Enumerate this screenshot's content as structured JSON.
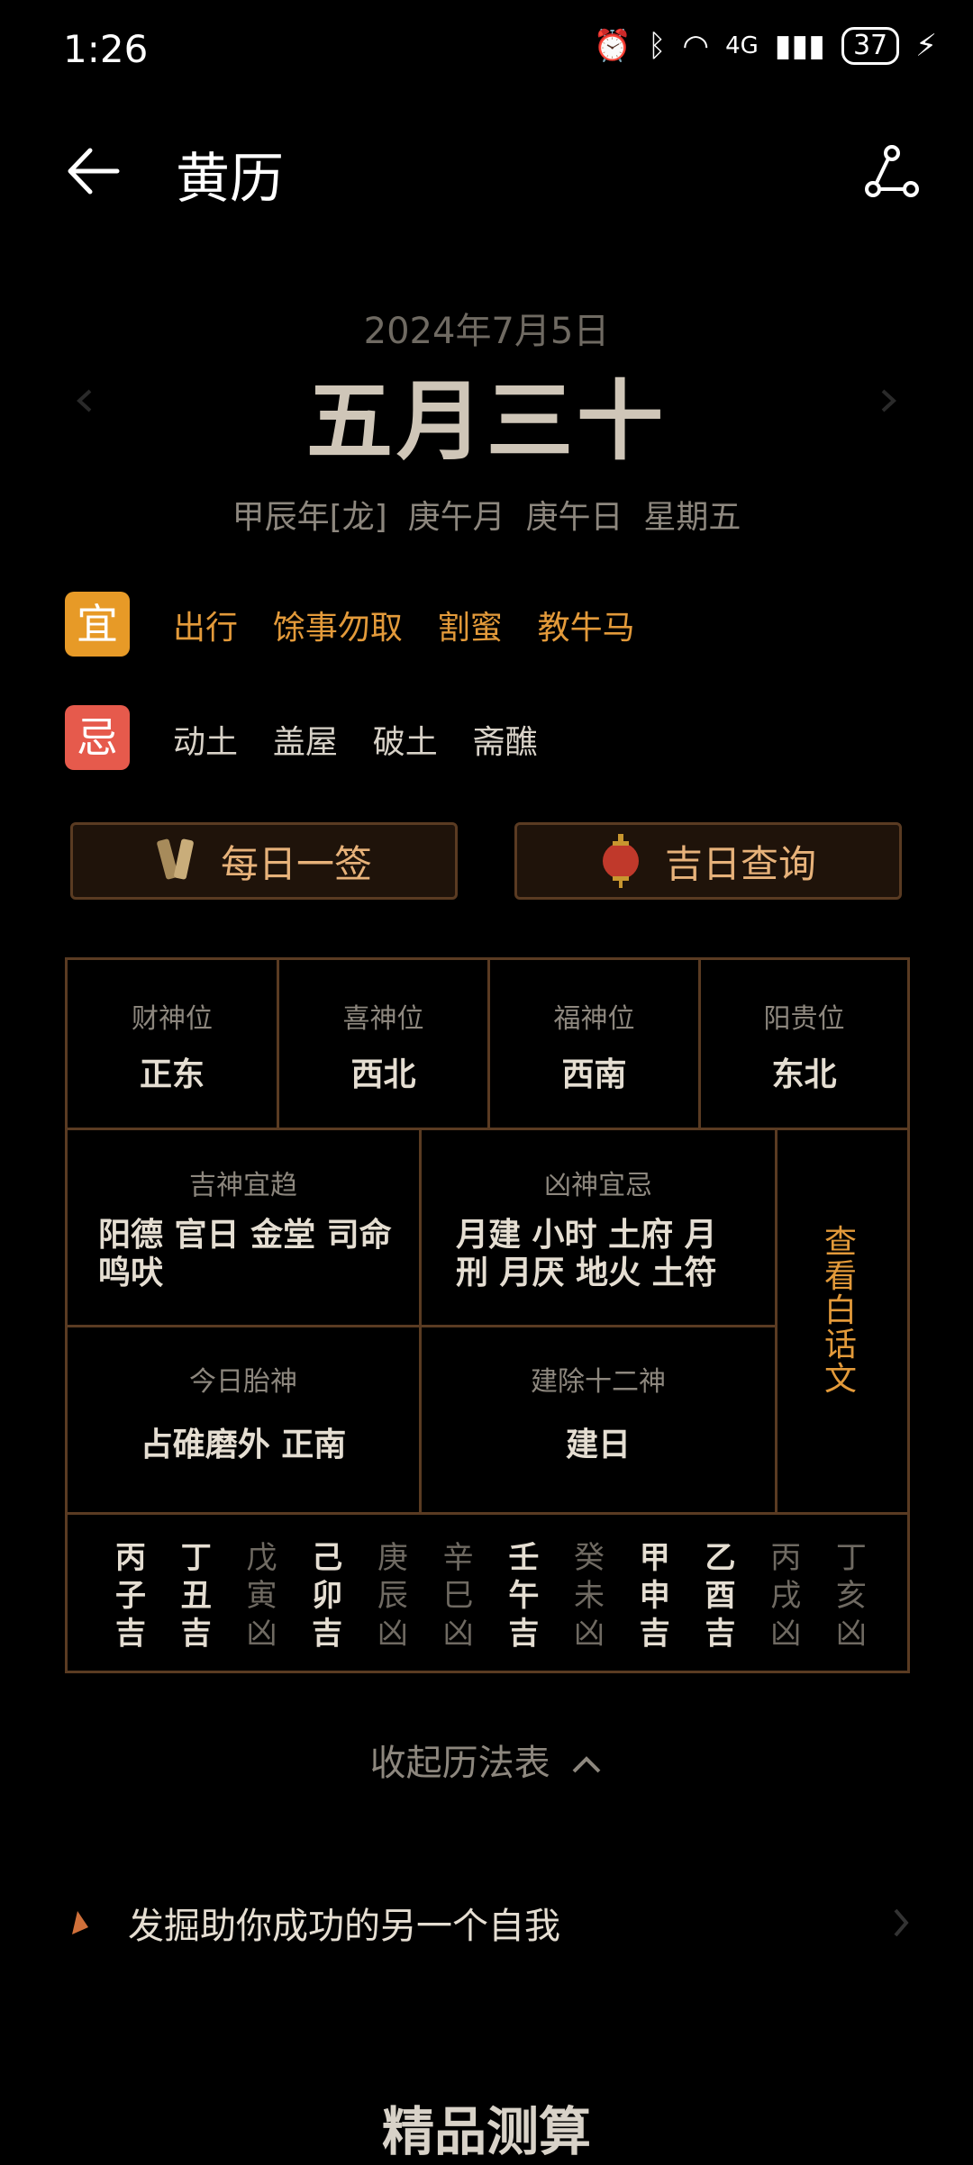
{
  "status": {
    "time": "1:26",
    "battery": "37",
    "network": "4G"
  },
  "header": {
    "title": "黄历"
  },
  "date": {
    "gregorian": "2024年7月5日",
    "lunar": "五月三十",
    "ganzhi": "甲辰年[龙]  庚午月  庚午日  星期五"
  },
  "yi": {
    "badge": "宜",
    "items": "出行  馀事勿取  割蜜  教牛马"
  },
  "ji": {
    "badge": "忌",
    "items": "动土  盖屋  破土  斋醮"
  },
  "buttons": {
    "daily": "每日一签",
    "lucky": "吉日查询"
  },
  "table": {
    "directions": [
      {
        "label": "财神位",
        "value": "正东"
      },
      {
        "label": "喜神位",
        "value": "西北"
      },
      {
        "label": "福神位",
        "value": "西南"
      },
      {
        "label": "阳贵位",
        "value": "东北"
      }
    ],
    "jishen": {
      "label": "吉神宜趋",
      "value": "阳德 官日 金堂 司命 鸣吠"
    },
    "xiongshen": {
      "label": "凶神宜忌",
      "value": "月建 小时 土府 月刑 月厌 地火 土符"
    },
    "view_text": "查看白话文",
    "taishen": {
      "label": "今日胎神",
      "value": "占碓磨外 正南"
    },
    "jianchu": {
      "label": "建除十二神",
      "value": "建日"
    },
    "hours": [
      {
        "stem": "丙",
        "branch": "子",
        "luck": "吉"
      },
      {
        "stem": "丁",
        "branch": "丑",
        "luck": "吉"
      },
      {
        "stem": "戊",
        "branch": "寅",
        "luck": "凶"
      },
      {
        "stem": "己",
        "branch": "卯",
        "luck": "吉"
      },
      {
        "stem": "庚",
        "branch": "辰",
        "luck": "凶"
      },
      {
        "stem": "辛",
        "branch": "巳",
        "luck": "凶"
      },
      {
        "stem": "壬",
        "branch": "午",
        "luck": "吉"
      },
      {
        "stem": "癸",
        "branch": "未",
        "luck": "凶"
      },
      {
        "stem": "甲",
        "branch": "申",
        "luck": "吉"
      },
      {
        "stem": "乙",
        "branch": "酉",
        "luck": "吉"
      },
      {
        "stem": "丙",
        "branch": "戌",
        "luck": "凶"
      },
      {
        "stem": "丁",
        "branch": "亥",
        "luck": "凶"
      }
    ]
  },
  "collapse_label": "收起历法表",
  "promo": {
    "text": "发掘助你成功的另一个自我"
  },
  "section": {
    "title": "精品测算"
  },
  "colors": {
    "accent": "#e39a3a",
    "yi": "#e79a27",
    "ji": "#e65a4c",
    "border": "#5a3b22"
  }
}
